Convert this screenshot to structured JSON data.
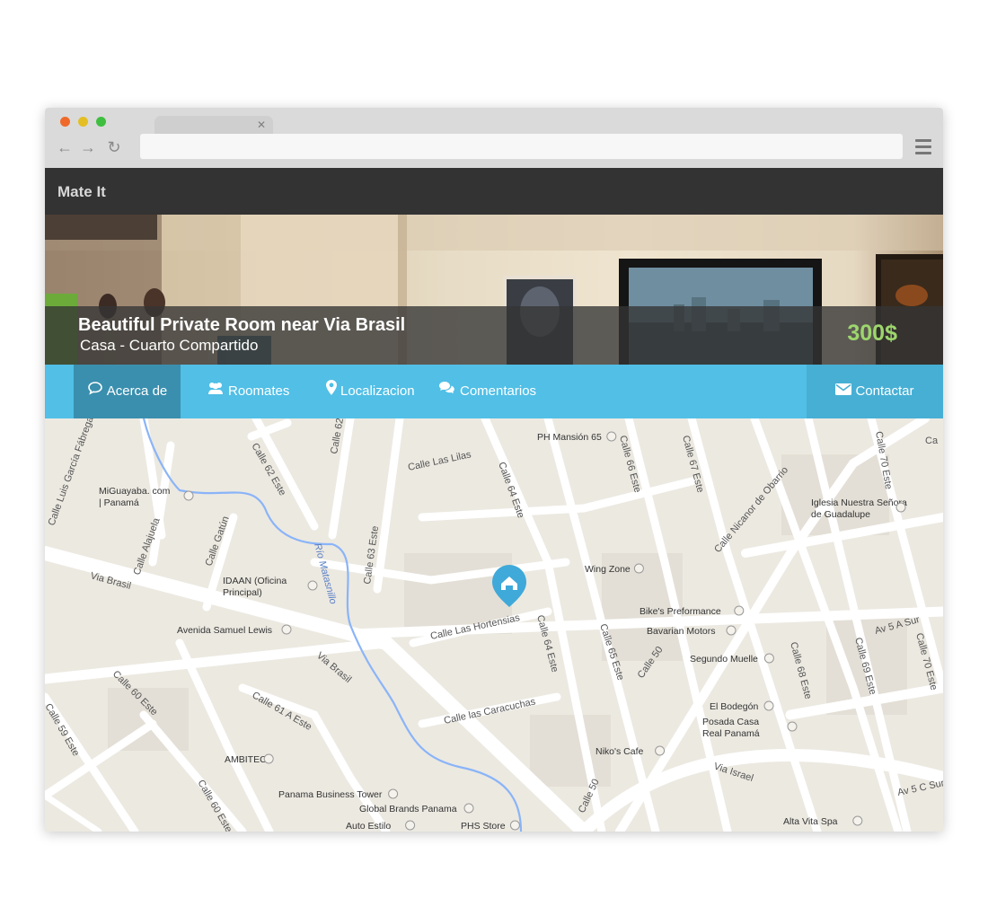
{
  "browser": {
    "url": ""
  },
  "app": {
    "brand": "Mate It"
  },
  "listing": {
    "title": "Beautiful Private Room near Via Brasil",
    "subtitle": "Casa - Cuarto Compartido",
    "price": "300$"
  },
  "nav": {
    "tabs": [
      {
        "label": "Acerca de",
        "icon": "comment-icon",
        "active": true
      },
      {
        "label": "Roomates",
        "icon": "users-icon",
        "active": false
      },
      {
        "label": "Localizacion",
        "icon": "map-marker-icon",
        "active": false
      },
      {
        "label": "Comentarios",
        "icon": "comments-icon",
        "active": false
      }
    ],
    "contact": {
      "label": "Contactar",
      "icon": "envelope-icon"
    }
  },
  "map": {
    "streets": [
      "Calle Luis García Fábrega",
      "Calle 62 Este",
      "Calle 62 A Este",
      "Calle Las Lilas",
      "Calle 64 Este",
      "Calle 66 Este",
      "Calle 67 Este",
      "Calle Nicanor de Obarrio",
      "Calle 70 Este",
      "Ca",
      "Calle Alajuela",
      "Calle Gatún",
      "Río Matasnillo",
      "Calle 63 Este",
      "Via Brasil",
      "Via Brasil",
      "Calle Las Hortensias",
      "Calle 64 Este",
      "Calle 65 Este",
      "Calle 50",
      "Av 5 A Sur",
      "Calle 68 Este",
      "Calle 69 Este",
      "Calle 70 Este",
      "Calle 60 Este",
      "Calle 61 A Este",
      "Calle las Caracuchas",
      "Calle 59 Este",
      "Calle 60 Este",
      "Calle 50",
      "Via Israel",
      "Av 5 C Sur"
    ],
    "places": [
      "PH Mansión 65",
      "MiGuayaba. com | Panamá",
      "Iglesia Nuestra Señora de Guadalupe",
      "IDAAN (Oficina Principal)",
      "Wing Zone",
      "Bike's Preformance",
      "Bavarian Motors",
      "Avenida Samuel Lewis",
      "Segundo Muelle",
      "El Bodegón",
      "Posada Casa Real Panamá",
      "Niko's Cafe",
      "AMBITEC",
      "Panama Business Tower",
      "Global Brands Panama",
      "Auto Estilo",
      "PHS Store",
      "Alta Vita Spa"
    ],
    "marker": "home-marker-icon",
    "colors": {
      "land": "#ece9e1",
      "road": "#ffffff",
      "river": "#8ab4f8",
      "marker": "#3fa9d9",
      "label": "#555555"
    }
  },
  "colors": {
    "accent": "#51bfe6",
    "active_tab": "#3a8fae",
    "price": "#9dd66d",
    "appbar": "#333333"
  }
}
